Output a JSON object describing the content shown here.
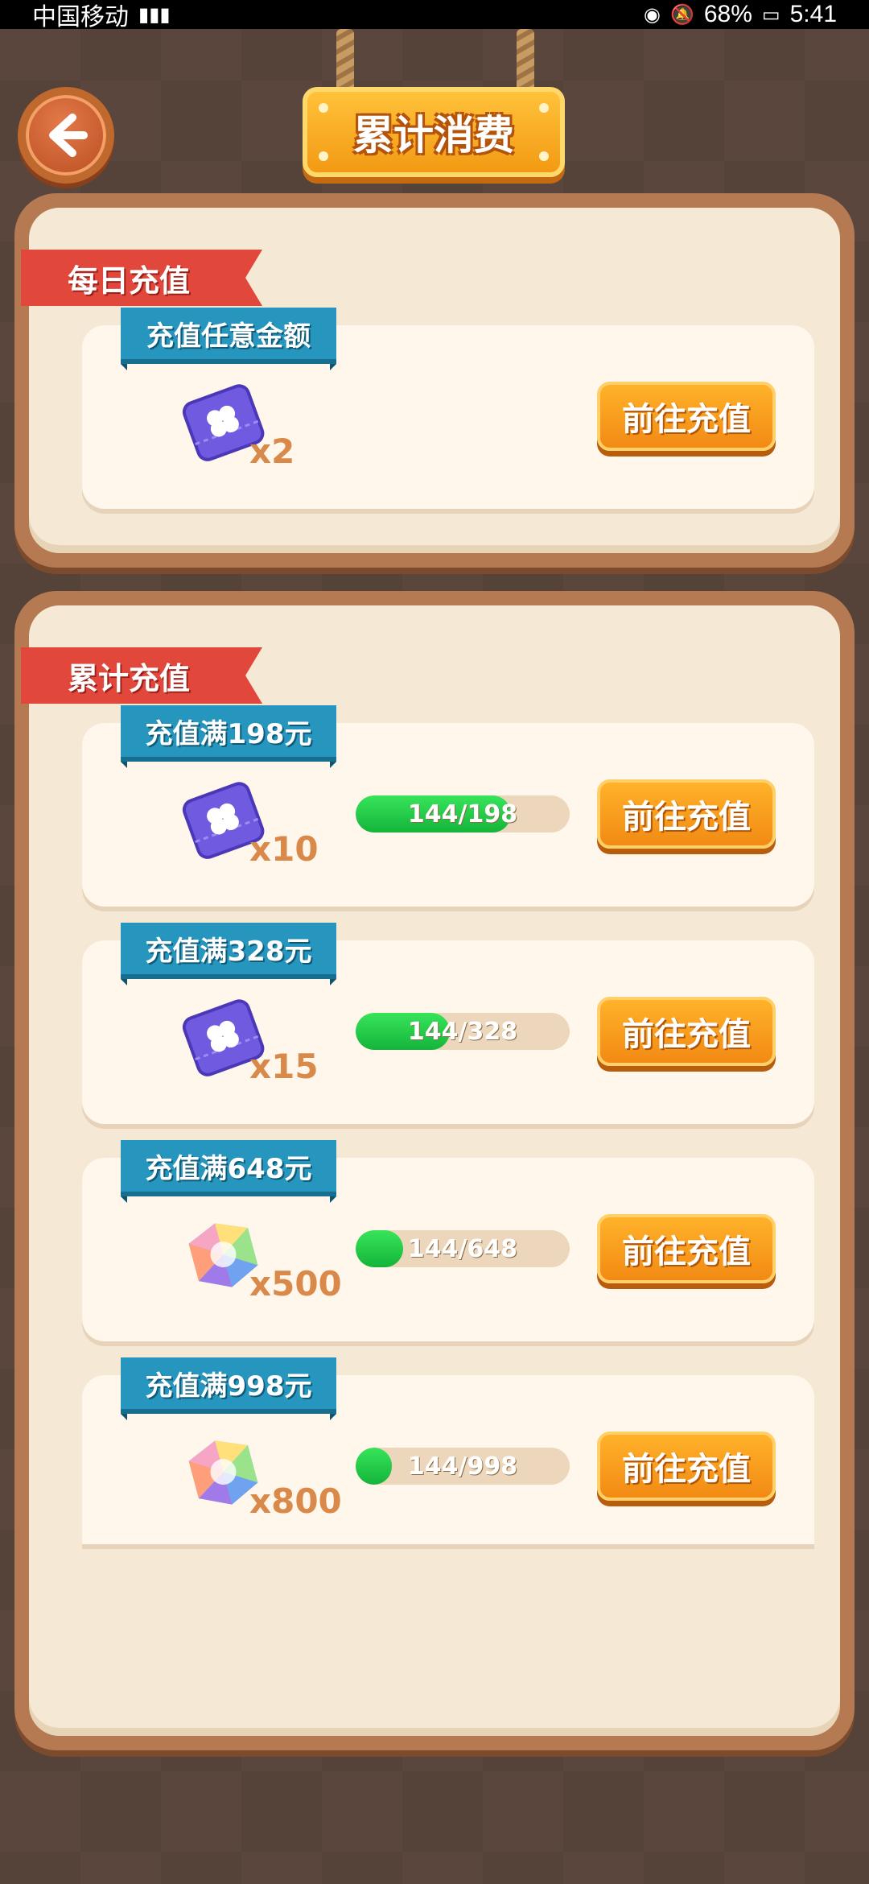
{
  "status_bar": {
    "carrier": "中国移动",
    "battery": "68%",
    "time": "5:41"
  },
  "header": {
    "title": "累计消费",
    "back_icon": "arrow-left-icon"
  },
  "daily": {
    "ribbon": "每日充值",
    "card": {
      "tag": "充值任意金额",
      "reward_icon": "ticket-clover-icon",
      "quantity": "x2",
      "button": "前往充值"
    }
  },
  "cumulative": {
    "ribbon": "累计充值",
    "cards": [
      {
        "tag": "充值满198元",
        "reward_icon": "ticket-clover-icon",
        "quantity": "x10",
        "progress_text": "144/198",
        "progress": 0.727,
        "button": "前往充值"
      },
      {
        "tag": "充值满328元",
        "reward_icon": "ticket-clover-icon",
        "quantity": "x15",
        "progress_text": "144/328",
        "progress": 0.439,
        "button": "前往充值"
      },
      {
        "tag": "充值满648元",
        "reward_icon": "rainbow-gem-icon",
        "quantity": "x500",
        "progress_text": "144/648",
        "progress": 0.222,
        "button": "前往充值"
      },
      {
        "tag": "充值满998元",
        "reward_icon": "rainbow-gem-icon",
        "quantity": "x800",
        "progress_text": "144/998",
        "progress": 0.144,
        "button": "前往充值"
      }
    ]
  },
  "colors": {
    "ribbon": "#e2473b",
    "tag": "#2696bf",
    "button": "#f28a14",
    "progress": "#14b43a"
  }
}
